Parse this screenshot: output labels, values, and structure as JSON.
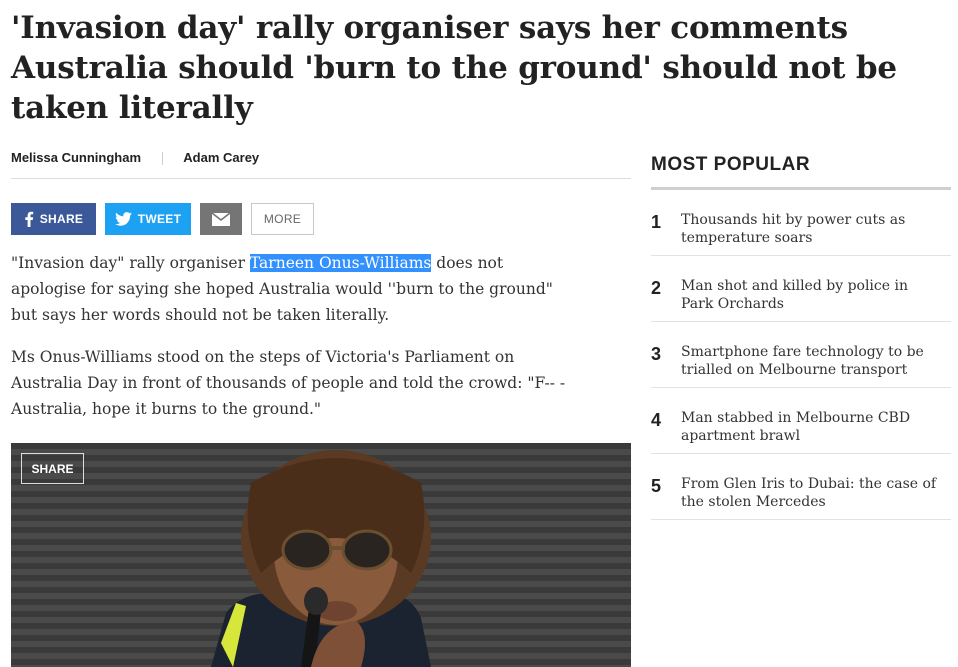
{
  "article": {
    "headline": "'Invasion day' rally organiser says her comments Australia should 'burn to the ground' should not be taken literally",
    "authors": [
      "Melissa Cunningham",
      "Adam Carey"
    ],
    "share": {
      "facebook": "SHARE",
      "twitter": "TWEET",
      "more": "MORE"
    },
    "p1_before": "\"Invasion day\" rally organiser ",
    "p1_highlight": "Tarneen Onus-Williams",
    "p1_after": " does not apologise for saying she hoped Australia would ''burn to the ground\" but says her words should not be taken literally.",
    "p2": "Ms Onus-Williams stood on the steps of Victoria's Parliament on Australia Day in front of thousands of people and told the crowd: \"F-- - Australia, hope it burns to the ground.\"",
    "photo_share": "SHARE"
  },
  "most_popular": {
    "title": "MOST POPULAR",
    "items": [
      {
        "num": "1",
        "text": "Thousands hit by power cuts as temperature soars"
      },
      {
        "num": "2",
        "text": "Man shot and killed by police in Park Orchards"
      },
      {
        "num": "3",
        "text": "Smartphone fare technology to be trialled on Melbourne transport"
      },
      {
        "num": "4",
        "text": "Man stabbed in Melbourne CBD apartment brawl"
      },
      {
        "num": "5",
        "text": "From Glen Iris to Dubai: the case of the stolen Mercedes"
      }
    ]
  },
  "colors": {
    "facebook": "#3b5998",
    "twitter": "#1da1f2",
    "email": "#757575",
    "highlight": "#3390ff"
  }
}
